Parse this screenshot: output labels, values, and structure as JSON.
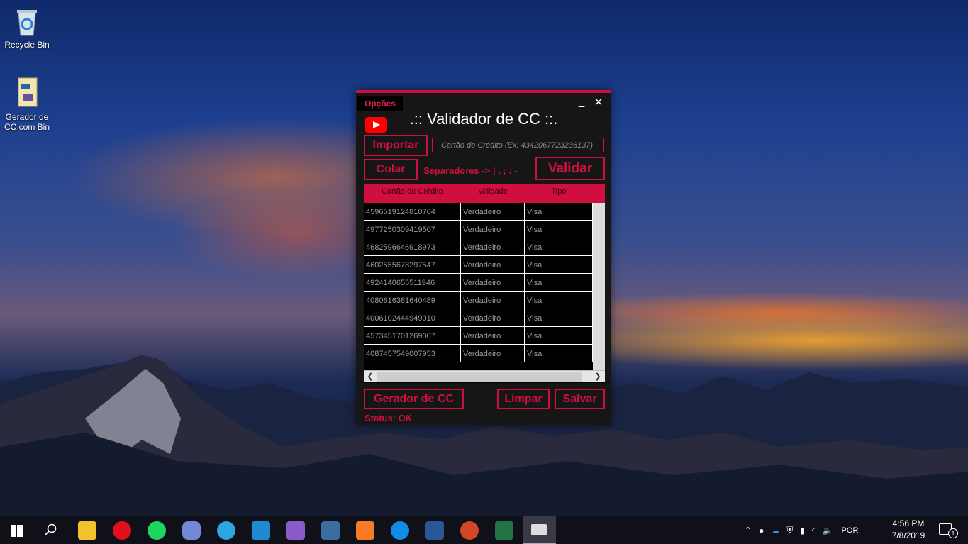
{
  "desktop": {
    "icons": [
      {
        "label": "Recycle Bin",
        "icon": "recycle-bin-icon"
      },
      {
        "label": "Gerador de CC com Bin",
        "icon": "file-icon"
      }
    ]
  },
  "app": {
    "menu": "Opções",
    "title": ".:: Validador de CC ::.",
    "buttons": {
      "importar": "Importar",
      "colar": "Colar",
      "validar": "Validar",
      "gerador": "Gerador de CC",
      "limpar": "Limpar",
      "salvar": "Salvar"
    },
    "input_placeholder": "Cartão de Crédito (Ex: 4342067723236137)",
    "separators": "Separadores -> | , ; : -",
    "columns": [
      "Cartão de Crédito",
      "Validade",
      "Tipo"
    ],
    "rows": [
      [
        "4596519124810764",
        "Verdadeiro",
        "Visa"
      ],
      [
        "4977250309419507",
        "Verdadeiro",
        "Visa"
      ],
      [
        "4682596646918973",
        "Verdadeiro",
        "Visa"
      ],
      [
        "4602555678297547",
        "Verdadeiro",
        "Visa"
      ],
      [
        "4924140655511946",
        "Verdadeiro",
        "Visa"
      ],
      [
        "4080616381640489",
        "Verdadeiro",
        "Visa"
      ],
      [
        "4006102444949010",
        "Verdadeiro",
        "Visa"
      ],
      [
        "4573451701269007",
        "Verdadeiro",
        "Visa"
      ],
      [
        "4087457549007953",
        "Verdadeiro",
        "Visa"
      ]
    ],
    "status": "Status: OK",
    "window_controls": {
      "minimize": "_",
      "close": "✕"
    },
    "accent": "#d10f3f"
  },
  "taskbar": {
    "apps": [
      "start-icon",
      "search-icon",
      "file-explorer-icon",
      "opera-icon",
      "spotify-icon",
      "discord-icon",
      "telegram-icon",
      "vscode-icon",
      "visual-studio-icon",
      "mysql-workbench-icon",
      "xampp-icon",
      "teamviewer-icon",
      "word-icon",
      "powerpoint-icon",
      "excel-icon",
      "cc-app-icon"
    ],
    "language": "POR",
    "time": "4:56 PM",
    "date": "7/8/2019",
    "notifications": "1"
  }
}
